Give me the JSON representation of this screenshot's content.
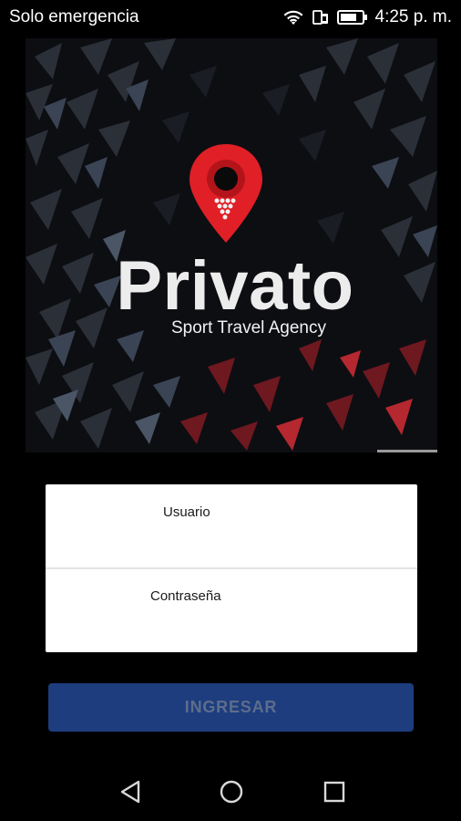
{
  "status_bar": {
    "carrier": "Solo emergencia",
    "time": "4:25 p. m.",
    "icons": [
      "wifi-icon",
      "sim-card-icon",
      "battery-icon"
    ]
  },
  "banner": {
    "brand_title": "Privato",
    "brand_subtitle": "Sport Travel Agency",
    "logo_icon": "location-pin-icon",
    "accent_color": "#e01f26"
  },
  "login_form": {
    "username_label": "Usuario",
    "password_label": "Contraseña",
    "username_value": "",
    "password_value": ""
  },
  "login_button": {
    "label": "INGRESAR",
    "color": "#1d3d7f"
  },
  "nav_bar": {
    "icons": [
      "back-icon",
      "home-icon",
      "recents-icon"
    ]
  }
}
